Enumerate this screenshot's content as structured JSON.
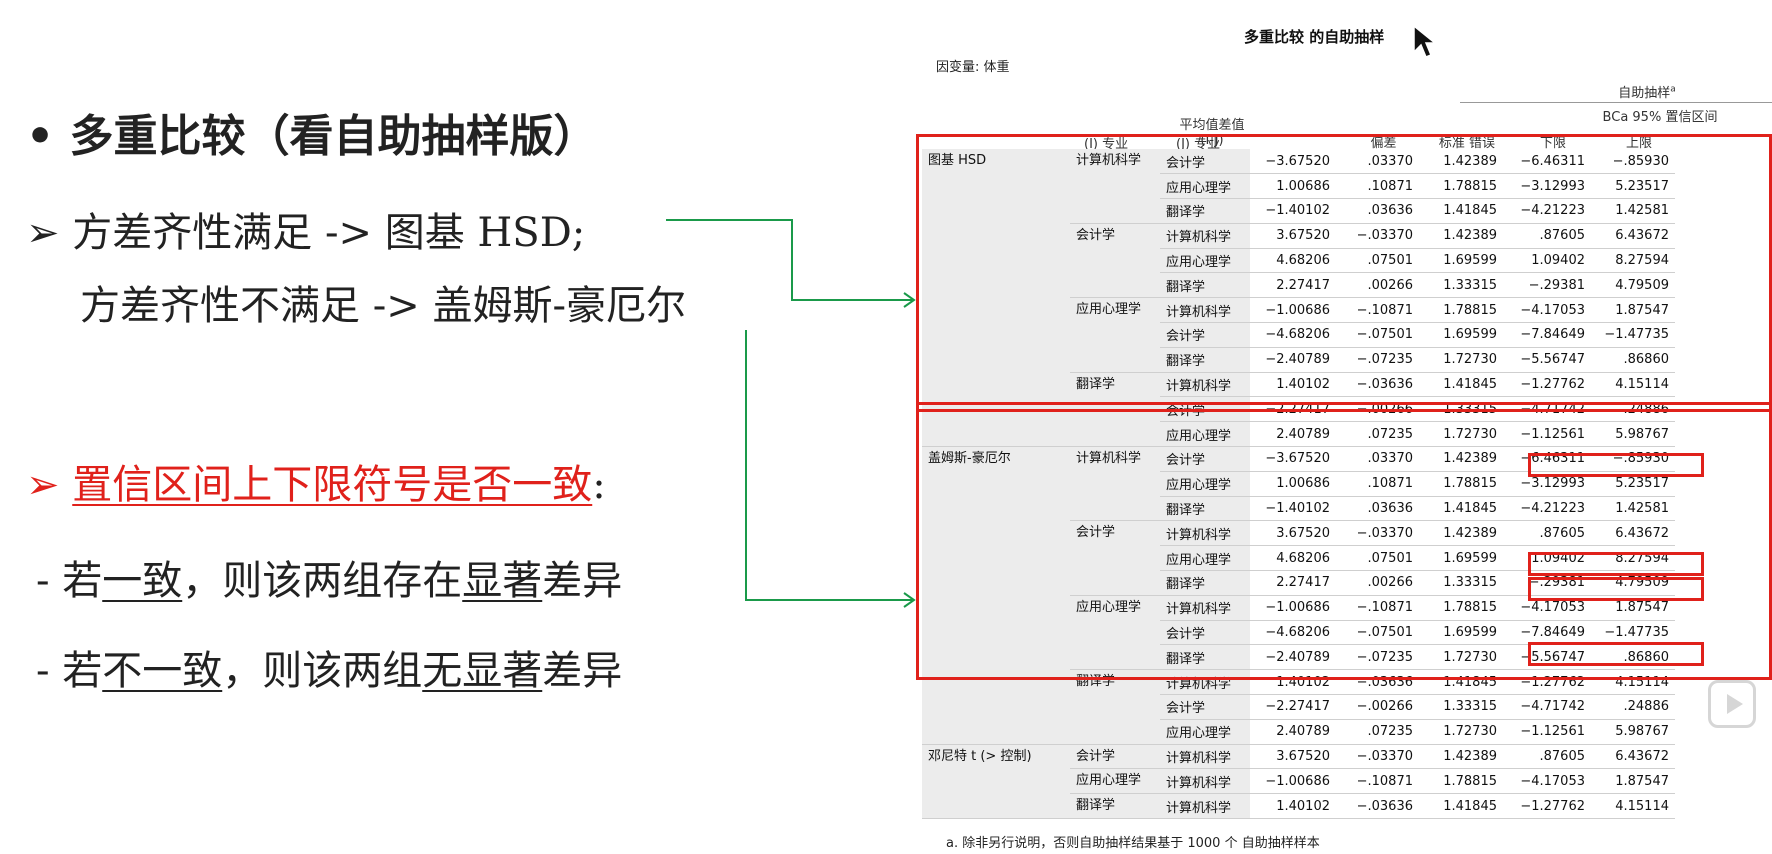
{
  "slide": {
    "b1": "• 多重比较（看自助抽样版）",
    "b2_prefix": "➢ ",
    "b2": "方差齐性满足 -> 图基 HSD;",
    "b3": "方差齐性不满足 -> 盖姆斯-豪厄尔",
    "b4_prefix": "➢ ",
    "b4": "置信区间上下限符号是否一致",
    "b4_colon": ":",
    "b5": {
      "p1": "- 若",
      "u1": "一致",
      "p2": "，则该两组存在",
      "u2": "显著",
      "p3": "差异"
    },
    "b6": {
      "p1": "- 若",
      "u1": "不一致",
      "p2": "，则该两组",
      "u2": "无显著",
      "p3": "差异"
    }
  },
  "table": {
    "title": "多重比较 的自助抽样",
    "dependent": "因变量:   体重",
    "header": {
      "i": "(I) 专业",
      "j": "(J) 专业",
      "mean": "平均值差值",
      "mean2": "(I-J)",
      "bootstrap": "自助抽样",
      "bootstrap_sup": "a",
      "bias": "偏差",
      "se": "标准 错误",
      "ci": "BCa 95% 置信区间",
      "lower": "下限",
      "upper": "上限"
    },
    "groups": [
      {
        "name": "图基 HSD",
        "blocks": [
          {
            "i": "计算机科学",
            "rows": [
              [
                "会计学",
                "-3.67520",
                ".03370",
                "1.42389",
                "-6.46311",
                "-.85930"
              ],
              [
                "应用心理学",
                "1.00686",
                ".10871",
                "1.78815",
                "-3.12993",
                "5.23517"
              ],
              [
                "翻译学",
                "-1.40102",
                ".03636",
                "1.41845",
                "-4.21223",
                "1.42581"
              ]
            ]
          },
          {
            "i": "会计学",
            "rows": [
              [
                "计算机科学",
                "3.67520",
                "-.03370",
                "1.42389",
                ".87605",
                "6.43672"
              ],
              [
                "应用心理学",
                "4.68206",
                ".07501",
                "1.69599",
                "1.09402",
                "8.27594"
              ],
              [
                "翻译学",
                "2.27417",
                ".00266",
                "1.33315",
                "-.29381",
                "4.79509"
              ]
            ]
          },
          {
            "i": "应用心理学",
            "rows": [
              [
                "计算机科学",
                "-1.00686",
                "-.10871",
                "1.78815",
                "-4.17053",
                "1.87547"
              ],
              [
                "会计学",
                "-4.68206",
                "-.07501",
                "1.69599",
                "-7.84649",
                "-1.47735"
              ],
              [
                "翻译学",
                "-2.40789",
                "-.07235",
                "1.72730",
                "-5.56747",
                ".86860"
              ]
            ]
          },
          {
            "i": "翻译学",
            "rows": [
              [
                "计算机科学",
                "1.40102",
                "-.03636",
                "1.41845",
                "-1.27762",
                "4.15114"
              ],
              [
                "会计学",
                "-2.27417",
                "-.00266",
                "1.33315",
                "-4.71742",
                ".24886"
              ],
              [
                "应用心理学",
                "2.40789",
                ".07235",
                "1.72730",
                "-1.12561",
                "5.98767"
              ]
            ]
          }
        ]
      },
      {
        "name": "盖姆斯-豪厄尔",
        "blocks": [
          {
            "i": "计算机科学",
            "rows": [
              [
                "会计学",
                "-3.67520",
                ".03370",
                "1.42389",
                "-6.46311",
                "-.85930"
              ],
              [
                "应用心理学",
                "1.00686",
                ".10871",
                "1.78815",
                "-3.12993",
                "5.23517"
              ],
              [
                "翻译学",
                "-1.40102",
                ".03636",
                "1.41845",
                "-4.21223",
                "1.42581"
              ]
            ]
          },
          {
            "i": "会计学",
            "rows": [
              [
                "计算机科学",
                "3.67520",
                "-.03370",
                "1.42389",
                ".87605",
                "6.43672"
              ],
              [
                "应用心理学",
                "4.68206",
                ".07501",
                "1.69599",
                "1.09402",
                "8.27594"
              ],
              [
                "翻译学",
                "2.27417",
                ".00266",
                "1.33315",
                "-.29381",
                "4.79509"
              ]
            ]
          },
          {
            "i": "应用心理学",
            "rows": [
              [
                "计算机科学",
                "-1.00686",
                "-.10871",
                "1.78815",
                "-4.17053",
                "1.87547"
              ],
              [
                "会计学",
                "-4.68206",
                "-.07501",
                "1.69599",
                "-7.84649",
                "-1.47735"
              ],
              [
                "翻译学",
                "-2.40789",
                "-.07235",
                "1.72730",
                "-5.56747",
                ".86860"
              ]
            ]
          },
          {
            "i": "翻译学",
            "rows": [
              [
                "计算机科学",
                "1.40102",
                "-.03636",
                "1.41845",
                "-1.27762",
                "4.15114"
              ],
              [
                "会计学",
                "-2.27417",
                "-.00266",
                "1.33315",
                "-4.71742",
                ".24886"
              ],
              [
                "应用心理学",
                "2.40789",
                ".07235",
                "1.72730",
                "-1.12561",
                "5.98767"
              ]
            ]
          }
        ]
      },
      {
        "name": "邓尼特 t (> 控制)",
        "blocks": [
          {
            "i": "会计学",
            "rows": [
              [
                "计算机科学",
                "3.67520",
                "-.03370",
                "1.42389",
                ".87605",
                "6.43672"
              ]
            ]
          },
          {
            "i": "应用心理学",
            "rows": [
              [
                "计算机科学",
                "-1.00686",
                "-.10871",
                "1.78815",
                "-4.17053",
                "1.87547"
              ]
            ]
          },
          {
            "i": "翻译学",
            "rows": [
              [
                "计算机科学",
                "1.40102",
                "-.03636",
                "1.41845",
                "-1.27762",
                "4.15114"
              ]
            ]
          }
        ]
      }
    ],
    "footnote": "a. 除非另行说明，否则自助抽样结果基于 1000 个 自助抽样样本"
  },
  "colors": {
    "highlight": "#e0211b",
    "connector": "#1a9a4a"
  }
}
